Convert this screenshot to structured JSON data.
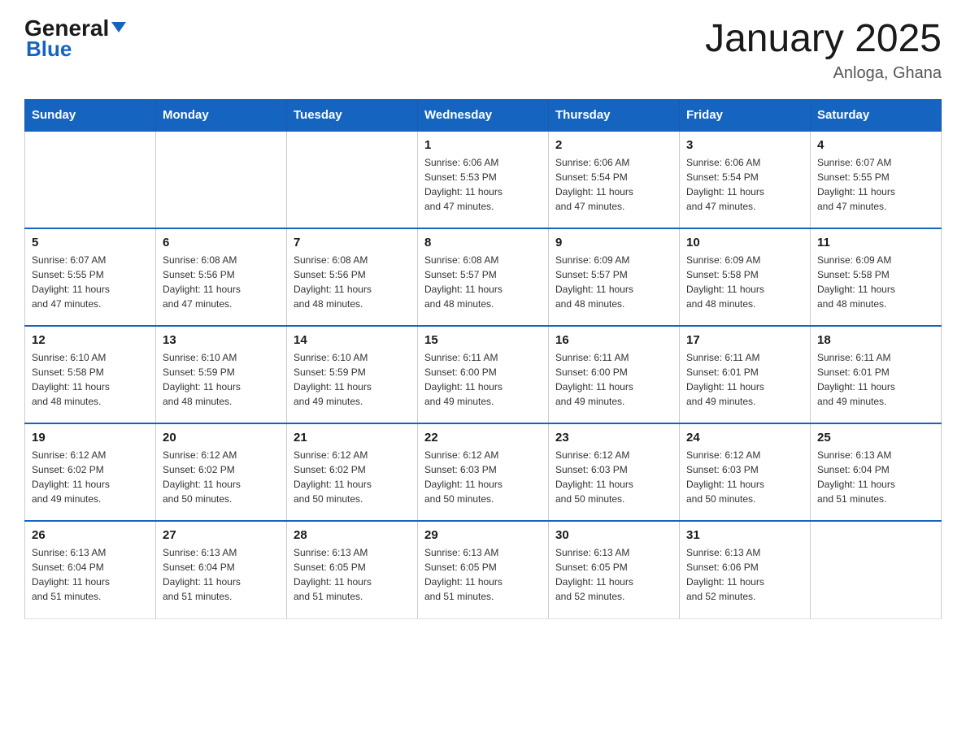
{
  "header": {
    "logo_general": "General",
    "logo_blue": "Blue",
    "month_title": "January 2025",
    "location": "Anloga, Ghana"
  },
  "days_of_week": [
    "Sunday",
    "Monday",
    "Tuesday",
    "Wednesday",
    "Thursday",
    "Friday",
    "Saturday"
  ],
  "weeks": [
    [
      {
        "day": "",
        "info": ""
      },
      {
        "day": "",
        "info": ""
      },
      {
        "day": "",
        "info": ""
      },
      {
        "day": "1",
        "info": "Sunrise: 6:06 AM\nSunset: 5:53 PM\nDaylight: 11 hours\nand 47 minutes."
      },
      {
        "day": "2",
        "info": "Sunrise: 6:06 AM\nSunset: 5:54 PM\nDaylight: 11 hours\nand 47 minutes."
      },
      {
        "day": "3",
        "info": "Sunrise: 6:06 AM\nSunset: 5:54 PM\nDaylight: 11 hours\nand 47 minutes."
      },
      {
        "day": "4",
        "info": "Sunrise: 6:07 AM\nSunset: 5:55 PM\nDaylight: 11 hours\nand 47 minutes."
      }
    ],
    [
      {
        "day": "5",
        "info": "Sunrise: 6:07 AM\nSunset: 5:55 PM\nDaylight: 11 hours\nand 47 minutes."
      },
      {
        "day": "6",
        "info": "Sunrise: 6:08 AM\nSunset: 5:56 PM\nDaylight: 11 hours\nand 47 minutes."
      },
      {
        "day": "7",
        "info": "Sunrise: 6:08 AM\nSunset: 5:56 PM\nDaylight: 11 hours\nand 48 minutes."
      },
      {
        "day": "8",
        "info": "Sunrise: 6:08 AM\nSunset: 5:57 PM\nDaylight: 11 hours\nand 48 minutes."
      },
      {
        "day": "9",
        "info": "Sunrise: 6:09 AM\nSunset: 5:57 PM\nDaylight: 11 hours\nand 48 minutes."
      },
      {
        "day": "10",
        "info": "Sunrise: 6:09 AM\nSunset: 5:58 PM\nDaylight: 11 hours\nand 48 minutes."
      },
      {
        "day": "11",
        "info": "Sunrise: 6:09 AM\nSunset: 5:58 PM\nDaylight: 11 hours\nand 48 minutes."
      }
    ],
    [
      {
        "day": "12",
        "info": "Sunrise: 6:10 AM\nSunset: 5:58 PM\nDaylight: 11 hours\nand 48 minutes."
      },
      {
        "day": "13",
        "info": "Sunrise: 6:10 AM\nSunset: 5:59 PM\nDaylight: 11 hours\nand 48 minutes."
      },
      {
        "day": "14",
        "info": "Sunrise: 6:10 AM\nSunset: 5:59 PM\nDaylight: 11 hours\nand 49 minutes."
      },
      {
        "day": "15",
        "info": "Sunrise: 6:11 AM\nSunset: 6:00 PM\nDaylight: 11 hours\nand 49 minutes."
      },
      {
        "day": "16",
        "info": "Sunrise: 6:11 AM\nSunset: 6:00 PM\nDaylight: 11 hours\nand 49 minutes."
      },
      {
        "day": "17",
        "info": "Sunrise: 6:11 AM\nSunset: 6:01 PM\nDaylight: 11 hours\nand 49 minutes."
      },
      {
        "day": "18",
        "info": "Sunrise: 6:11 AM\nSunset: 6:01 PM\nDaylight: 11 hours\nand 49 minutes."
      }
    ],
    [
      {
        "day": "19",
        "info": "Sunrise: 6:12 AM\nSunset: 6:02 PM\nDaylight: 11 hours\nand 49 minutes."
      },
      {
        "day": "20",
        "info": "Sunrise: 6:12 AM\nSunset: 6:02 PM\nDaylight: 11 hours\nand 50 minutes."
      },
      {
        "day": "21",
        "info": "Sunrise: 6:12 AM\nSunset: 6:02 PM\nDaylight: 11 hours\nand 50 minutes."
      },
      {
        "day": "22",
        "info": "Sunrise: 6:12 AM\nSunset: 6:03 PM\nDaylight: 11 hours\nand 50 minutes."
      },
      {
        "day": "23",
        "info": "Sunrise: 6:12 AM\nSunset: 6:03 PM\nDaylight: 11 hours\nand 50 minutes."
      },
      {
        "day": "24",
        "info": "Sunrise: 6:12 AM\nSunset: 6:03 PM\nDaylight: 11 hours\nand 50 minutes."
      },
      {
        "day": "25",
        "info": "Sunrise: 6:13 AM\nSunset: 6:04 PM\nDaylight: 11 hours\nand 51 minutes."
      }
    ],
    [
      {
        "day": "26",
        "info": "Sunrise: 6:13 AM\nSunset: 6:04 PM\nDaylight: 11 hours\nand 51 minutes."
      },
      {
        "day": "27",
        "info": "Sunrise: 6:13 AM\nSunset: 6:04 PM\nDaylight: 11 hours\nand 51 minutes."
      },
      {
        "day": "28",
        "info": "Sunrise: 6:13 AM\nSunset: 6:05 PM\nDaylight: 11 hours\nand 51 minutes."
      },
      {
        "day": "29",
        "info": "Sunrise: 6:13 AM\nSunset: 6:05 PM\nDaylight: 11 hours\nand 51 minutes."
      },
      {
        "day": "30",
        "info": "Sunrise: 6:13 AM\nSunset: 6:05 PM\nDaylight: 11 hours\nand 52 minutes."
      },
      {
        "day": "31",
        "info": "Sunrise: 6:13 AM\nSunset: 6:06 PM\nDaylight: 11 hours\nand 52 minutes."
      },
      {
        "day": "",
        "info": ""
      }
    ]
  ]
}
